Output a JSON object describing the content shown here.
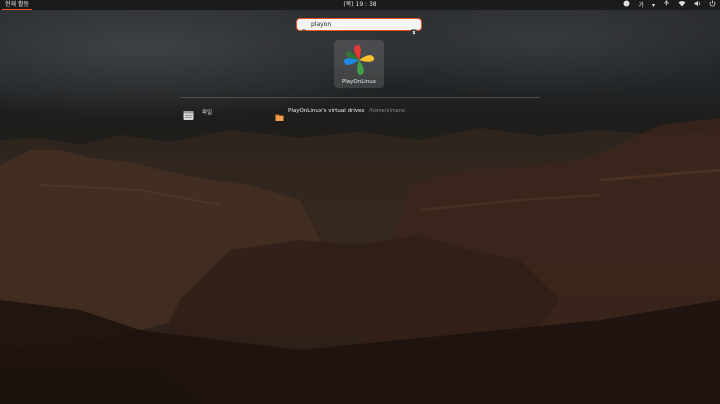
{
  "topbar": {
    "activities": "현재 활동",
    "clock": "(목) 19 : 38",
    "tray": {
      "input_method": "가",
      "language_dropdown": "▾"
    },
    "icons": [
      "input-method-icon",
      "accessibility-icon",
      "network-icon",
      "volume-icon",
      "power-icon"
    ]
  },
  "search": {
    "value": "playon",
    "placeholder": ""
  },
  "app_results": [
    {
      "label": "PlayOnLinux",
      "icon": "playonlinux-icon"
    }
  ],
  "provider": {
    "label": "파일",
    "icon": "files-icon"
  },
  "file_results": [
    {
      "title": "PlayOnLinux's virtual drives",
      "path": "/home/ximeno"
    }
  ],
  "colors": {
    "accent": "#e95420",
    "topbar": "#1b1b1b"
  }
}
